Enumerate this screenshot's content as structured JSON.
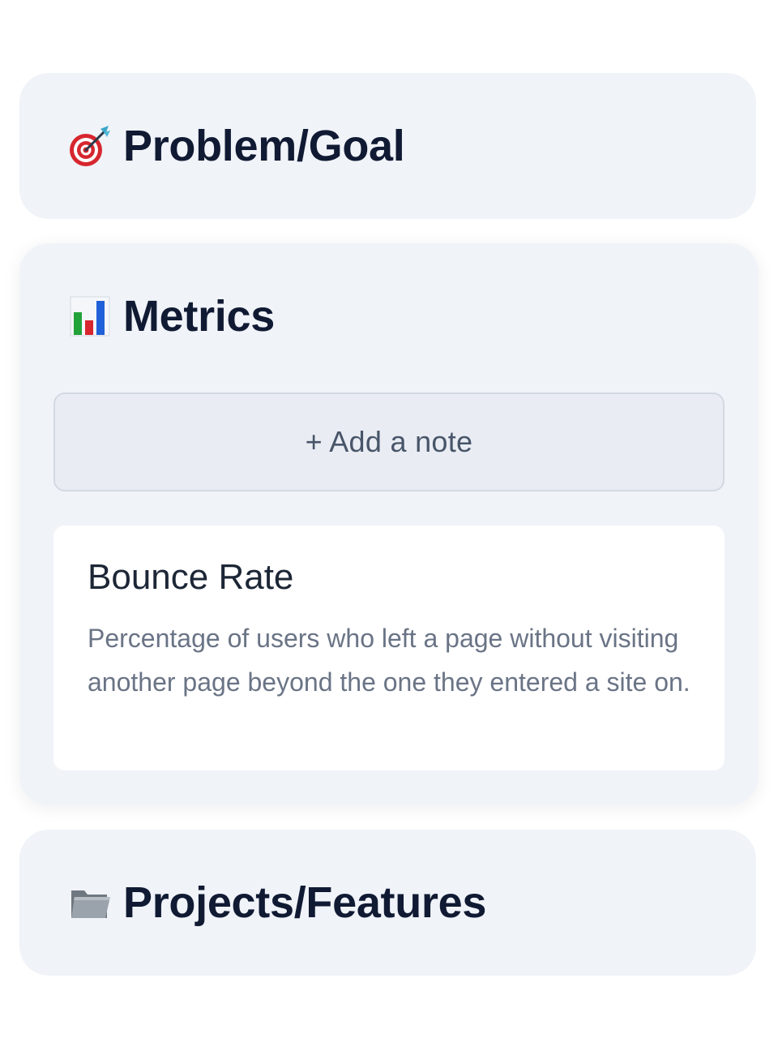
{
  "sections": {
    "problem": {
      "icon": "dart-target-icon",
      "title": "Problem/Goal"
    },
    "metrics": {
      "icon": "bar-chart-icon",
      "title": "Metrics",
      "add_note_label": "+ Add a note",
      "notes": [
        {
          "title": "Bounce Rate",
          "body": "Percentage of users who left a page without visiting another page beyond the one they entered a site on."
        }
      ]
    },
    "projects": {
      "icon": "folder-icon",
      "title": "Projects/Features"
    }
  },
  "colors": {
    "section_background": "#f0f3f8",
    "title_text": "#101a33",
    "note_body_text": "#6a7486",
    "target_red": "#d7262e",
    "bar_green": "#22a33a",
    "bar_red": "#d7262e",
    "bar_blue": "#2060d8",
    "folder_gray": "#8a939c"
  }
}
